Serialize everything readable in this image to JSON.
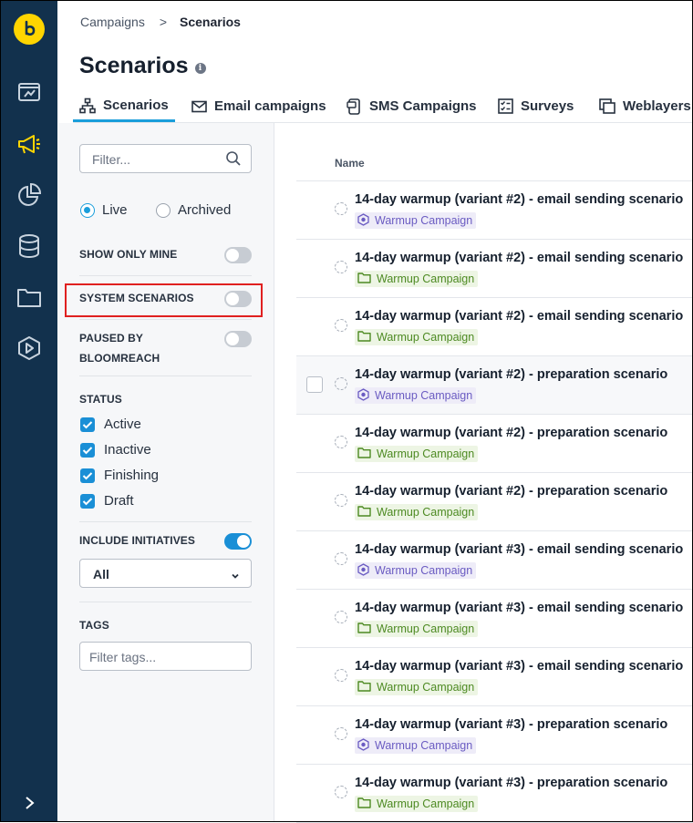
{
  "breadcrumb": {
    "parent": "Campaigns",
    "separator": ">",
    "current": "Scenarios"
  },
  "page": {
    "title": "Scenarios",
    "info_icon": "i"
  },
  "tabs": [
    {
      "label": "Scenarios",
      "icon": "flow-icon",
      "active": true
    },
    {
      "label": "Email campaigns",
      "icon": "envelope-icon"
    },
    {
      "label": "SMS Campaigns",
      "icon": "sms-icon"
    },
    {
      "label": "Surveys",
      "icon": "survey-icon"
    },
    {
      "label": "Weblayers",
      "icon": "weblayer-icon"
    }
  ],
  "filters": {
    "search_placeholder": "Filter...",
    "status_radio": [
      {
        "label": "Live",
        "selected": true
      },
      {
        "label": "Archived",
        "selected": false
      }
    ],
    "show_only_mine": {
      "label": "SHOW ONLY MINE",
      "on": false
    },
    "system_scenarios": {
      "label": "SYSTEM SCENARIOS",
      "on": false
    },
    "paused_by_bloomreach": {
      "label_line1": "PAUSED BY",
      "label_line2": "BLOOMREACH",
      "on": false
    },
    "status": {
      "heading": "STATUS",
      "options": [
        {
          "label": "Active",
          "checked": true
        },
        {
          "label": "Inactive",
          "checked": true
        },
        {
          "label": "Finishing",
          "checked": true
        },
        {
          "label": "Draft",
          "checked": true
        }
      ]
    },
    "include_initiatives": {
      "label": "INCLUDE INITIATIVES",
      "on": true
    },
    "initiatives_select": {
      "value": "All"
    },
    "tags": {
      "heading": "TAGS",
      "placeholder": "Filter tags..."
    }
  },
  "table": {
    "column_name": "Name",
    "rows": [
      {
        "name": "14-day warmup (variant #2) - email sending scenario",
        "tag": "Warmup Campaign",
        "tag_type": "initiative"
      },
      {
        "name": "14-day warmup (variant #2) - email sending scenario",
        "tag": "Warmup Campaign",
        "tag_type": "folder"
      },
      {
        "name": "14-day warmup (variant #2) - email sending scenario",
        "tag": "Warmup Campaign",
        "tag_type": "folder"
      },
      {
        "name": "14-day warmup (variant #2) - preparation scenario",
        "tag": "Warmup Campaign",
        "tag_type": "initiative"
      },
      {
        "name": "14-day warmup (variant #2) - preparation scenario",
        "tag": "Warmup Campaign",
        "tag_type": "folder"
      },
      {
        "name": "14-day warmup (variant #2) - preparation scenario",
        "tag": "Warmup Campaign",
        "tag_type": "folder"
      },
      {
        "name": "14-day warmup (variant #3) - email sending scenario",
        "tag": "Warmup Campaign",
        "tag_type": "initiative"
      },
      {
        "name": "14-day warmup (variant #3) - email sending scenario",
        "tag": "Warmup Campaign",
        "tag_type": "folder"
      },
      {
        "name": "14-day warmup (variant #3) - email sending scenario",
        "tag": "Warmup Campaign",
        "tag_type": "folder"
      },
      {
        "name": "14-day warmup (variant #3) - preparation scenario",
        "tag": "Warmup Campaign",
        "tag_type": "initiative"
      },
      {
        "name": "14-day warmup (variant #3) - preparation scenario",
        "tag": "Warmup Campaign",
        "tag_type": "folder"
      }
    ]
  },
  "colors": {
    "rail": "#12314d",
    "accent": "#1a8fd6",
    "logo": "#ffd500",
    "highlight": "#e02020"
  }
}
